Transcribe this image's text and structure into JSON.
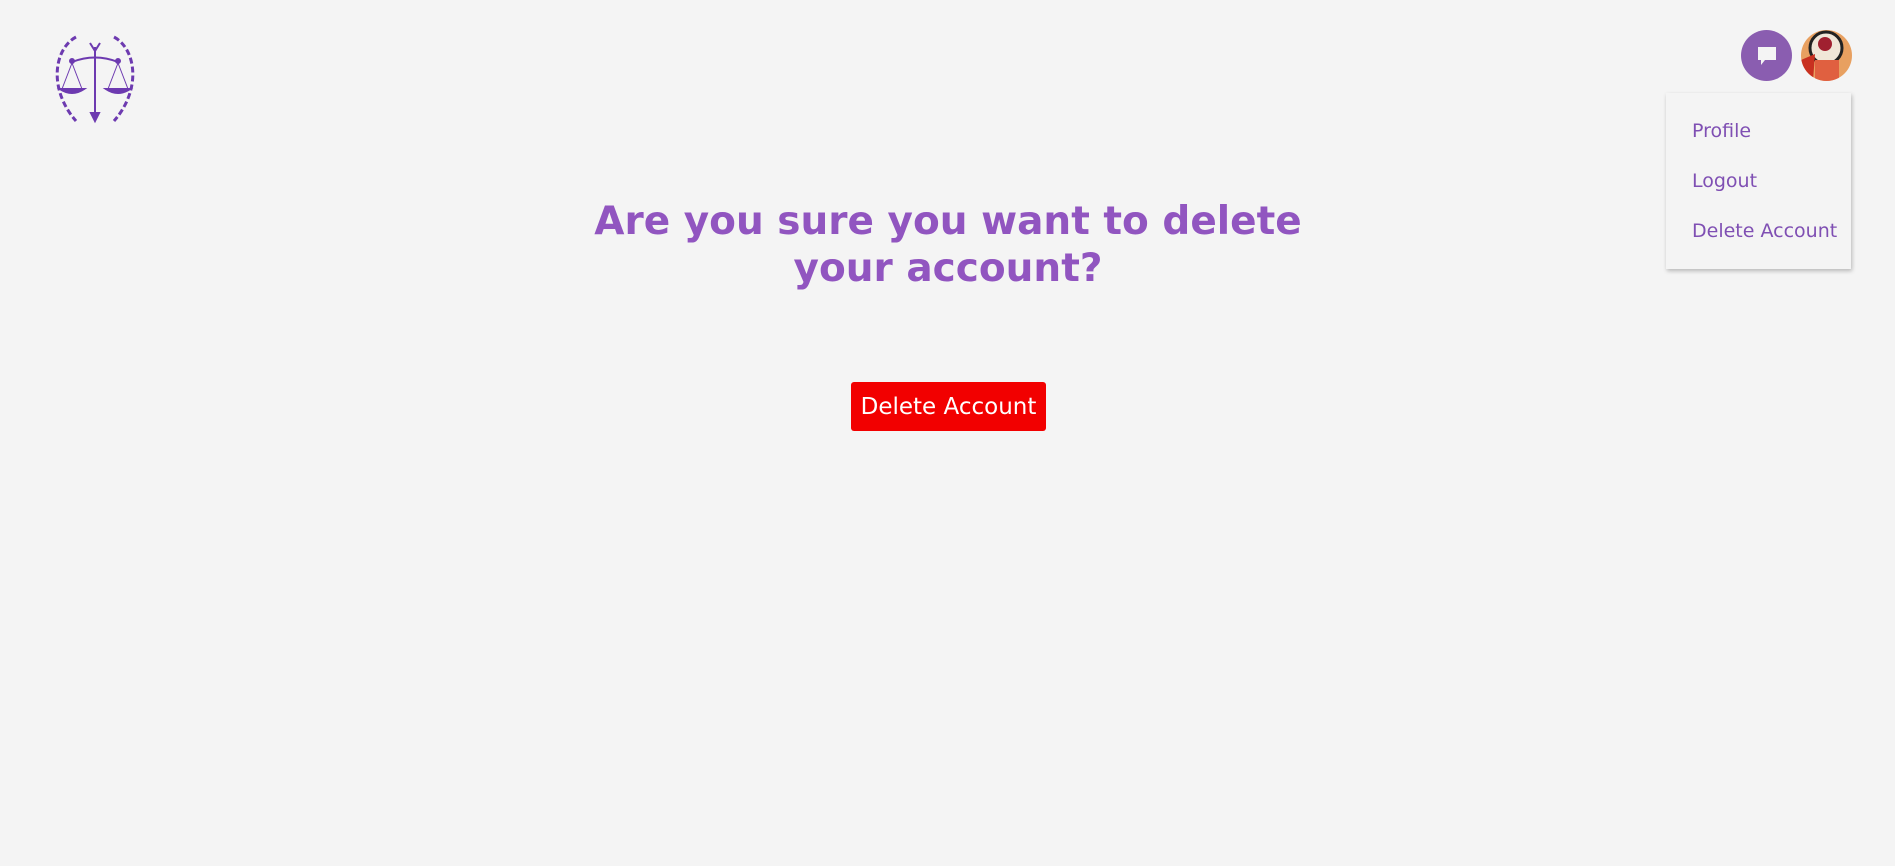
{
  "header": {
    "logo_icon": "scales-of-justice-laurel-logo",
    "chat_icon": "chat-bubble-icon",
    "accent_color": "#8a5db0"
  },
  "dropdown": {
    "items": [
      {
        "label": "Profile"
      },
      {
        "label": "Logout"
      },
      {
        "label": "Delete Account"
      }
    ]
  },
  "main": {
    "heading": "Are you sure you want to delete your account?",
    "delete_button_label": "Delete Account",
    "delete_button_color": "#f20000"
  }
}
